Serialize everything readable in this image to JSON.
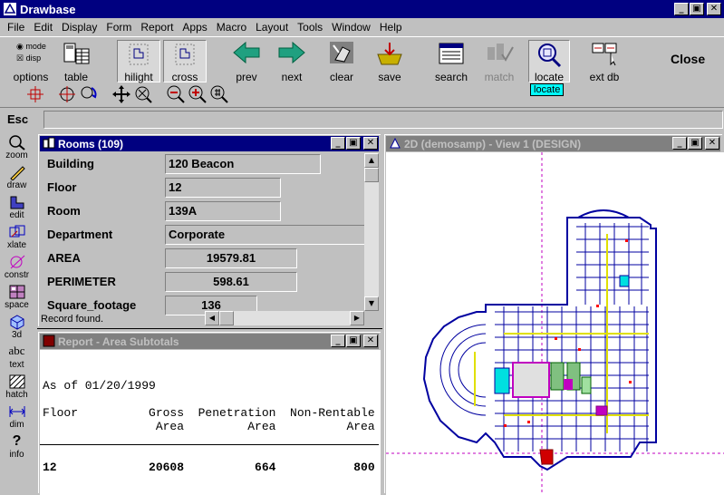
{
  "app": {
    "title": "Drawbase"
  },
  "titlebar": {
    "min": "_",
    "max": "▣",
    "close": "✕"
  },
  "menu": [
    {
      "label": "File"
    },
    {
      "label": "Edit"
    },
    {
      "label": "Display"
    },
    {
      "label": "Form"
    },
    {
      "label": "Report"
    },
    {
      "label": "Apps"
    },
    {
      "label": "Macro"
    },
    {
      "label": "Layout"
    },
    {
      "label": "Tools"
    },
    {
      "label": "Window"
    },
    {
      "label": "Help"
    }
  ],
  "toolbar": {
    "mode_label": "mode",
    "disp_label": "disp",
    "options": "options",
    "table": "table",
    "hilight": "hilight",
    "cross": "cross",
    "prev": "prev",
    "next": "next",
    "clear": "clear",
    "save": "save",
    "search": "search",
    "match": "match",
    "locate": "locate",
    "extdb": "ext db",
    "close": "Close",
    "tooltip": "locate"
  },
  "command": {
    "esc": "Esc",
    "value": ""
  },
  "palette": [
    {
      "label": "zoom",
      "icon": "magnifier-icon"
    },
    {
      "label": "draw",
      "icon": "pencil-icon"
    },
    {
      "label": "edit",
      "icon": "edit-icon"
    },
    {
      "label": "xlate",
      "icon": "translate-icon"
    },
    {
      "label": "constr",
      "icon": "construct-icon"
    },
    {
      "label": "space",
      "icon": "space-icon"
    },
    {
      "label": "3d",
      "icon": "cube-icon"
    },
    {
      "label": "text",
      "icon": "text-icon"
    },
    {
      "label": "hatch",
      "icon": "hatch-icon"
    },
    {
      "label": "dim",
      "icon": "dimension-icon"
    },
    {
      "label": "info",
      "icon": "question-icon"
    }
  ],
  "palette_text_glyph": "abc",
  "palette_info_glyph": "?",
  "rooms": {
    "title": "Rooms (109)",
    "fields": [
      {
        "label": "Building",
        "value": "120 Beacon"
      },
      {
        "label": "Floor",
        "value": "12"
      },
      {
        "label": "Room",
        "value": "139A"
      },
      {
        "label": "Department",
        "value": "Corporate"
      },
      {
        "label": "AREA",
        "value": "19579.81"
      },
      {
        "label": "PERIMETER",
        "value": "598.61"
      },
      {
        "label": "Square_footage",
        "value": "136"
      }
    ],
    "status": "Record found."
  },
  "report": {
    "title": "Report - Area Subtotals",
    "date_line": "As of 01/20/1999",
    "header1": "Floor          Gross  Penetration  Non-Rentable",
    "header2": "                Area         Area          Area",
    "row": "12             20608          664           800"
  },
  "view": {
    "title": "2D (demosamp) - View 1 (DESIGN)"
  },
  "colors": {
    "titlebar": "#000080",
    "inactive_title": "#808080",
    "tooltip": "#00ffff",
    "plan_line": "#0000a0",
    "crosshair": "#c000c0"
  }
}
